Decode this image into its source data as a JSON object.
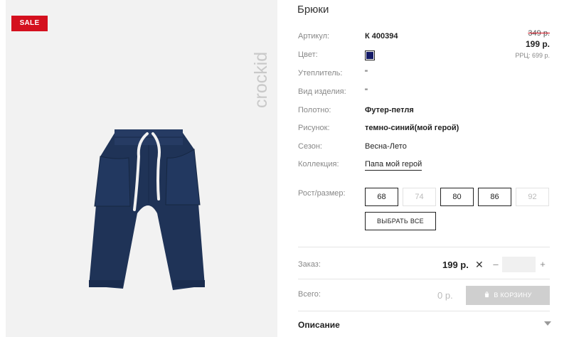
{
  "badge": {
    "sale": "SALE"
  },
  "brand": {
    "logo_text": "crockid"
  },
  "product": {
    "title": "Брюки",
    "price": {
      "old": "349 р.",
      "new": "199 р.",
      "rrp": "РРЦ: 699 р."
    },
    "attributes": [
      {
        "label": "Артикул:",
        "value": "К 400394"
      },
      {
        "label": "Цвет:",
        "value": "",
        "color": "#141a66"
      },
      {
        "label": "Утеплитель:",
        "value": "\""
      },
      {
        "label": "Вид изделия:",
        "value": "\""
      },
      {
        "label": "Полотно:",
        "value": "Футер-петля"
      },
      {
        "label": "Рисунок:",
        "value": "темно-синий(мой герой)"
      },
      {
        "label": "Сезон:",
        "value": "Весна-Лето"
      },
      {
        "label": "Коллекция:",
        "value": "Папа мой герой"
      }
    ],
    "sizes": {
      "label": "Рост/размер:",
      "options": [
        {
          "value": "68",
          "available": true
        },
        {
          "value": "74",
          "available": false
        },
        {
          "value": "80",
          "available": true
        },
        {
          "value": "86",
          "available": true
        },
        {
          "value": "92",
          "available": false
        }
      ],
      "select_all": "ВЫБРАТЬ ВСЕ"
    }
  },
  "order": {
    "label": "Заказ:",
    "price": "199 р.",
    "times": "✕",
    "minus": "–",
    "plus": "+",
    "quantity": ""
  },
  "total": {
    "label": "Всего:",
    "value": "0 р.",
    "cart_button": "В КОРЗИНУ"
  },
  "description": {
    "title": "Описание"
  },
  "colors": {
    "sale": "#d4101e",
    "product_navy": "#1f3357",
    "cart_disabled": "#cfcfcf"
  }
}
